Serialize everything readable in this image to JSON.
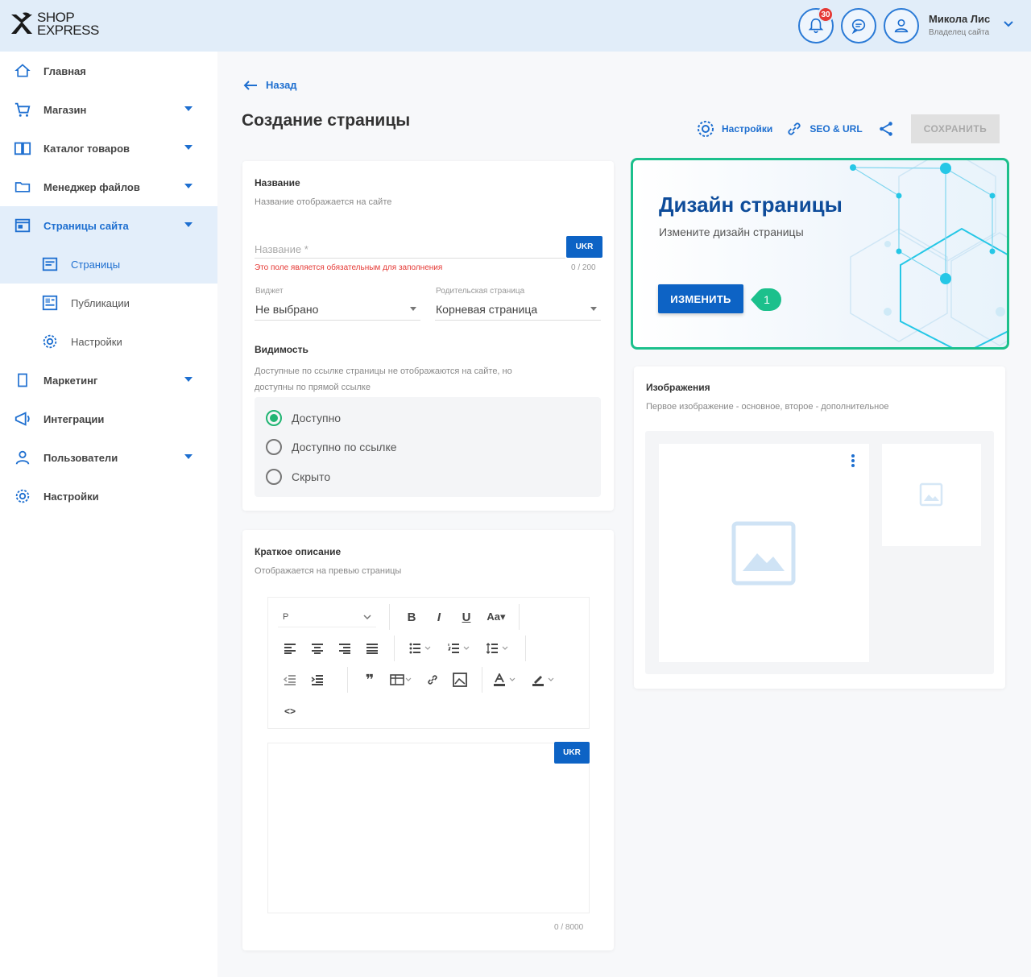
{
  "header": {
    "logo_line1": "SHOP",
    "logo_line2": "EXPRESS",
    "notification_count": "30",
    "user_name": "Микола Лис",
    "user_role": "Владелец сайта"
  },
  "sidebar": {
    "items": [
      {
        "label": "Главная",
        "icon": "home-icon",
        "has_chevron": false
      },
      {
        "label": "Магазин",
        "icon": "cart-icon",
        "has_chevron": true
      },
      {
        "label": "Каталог товаров",
        "icon": "book-icon",
        "has_chevron": true
      },
      {
        "label": "Менеджер файлов",
        "icon": "folder-icon",
        "has_chevron": true
      },
      {
        "label": "Страницы сайта",
        "icon": "pages-icon",
        "has_chevron": true,
        "active": true
      },
      {
        "label": "Маркетинг",
        "icon": "marketing-icon",
        "has_chevron": true
      },
      {
        "label": "Интеграции",
        "icon": "integrations-icon",
        "has_chevron": false
      },
      {
        "label": "Пользователи",
        "icon": "users-icon",
        "has_chevron": true
      },
      {
        "label": "Настройки",
        "icon": "gear-icon",
        "has_chevron": false
      }
    ],
    "sub_items": [
      {
        "label": "Страницы",
        "icon": "page-icon",
        "active": true
      },
      {
        "label": "Публикации",
        "icon": "news-icon"
      },
      {
        "label": "Настройки",
        "icon": "gear-icon"
      }
    ]
  },
  "main": {
    "back_label": "Назад",
    "page_title": "Создание страницы",
    "toolbar": {
      "settings_label": "Настройки",
      "seo_label": "SEO & URL",
      "save_label": "СОХРАНИТЬ"
    },
    "name_section": {
      "title": "Название",
      "hint": "Название отображается на сайте",
      "placeholder": "Название *",
      "lang": "UKR",
      "error": "Это поле является обязательным для заполнения",
      "counter": "0 / 200"
    },
    "widget": {
      "label": "Виджет",
      "value": "Не выбрано"
    },
    "parent": {
      "label": "Родительская страница",
      "value": "Корневая страница"
    },
    "visibility": {
      "title": "Видимость",
      "hint_line1": "Доступные по ссылке страницы не отображаются на сайте, но",
      "hint_line2": "доступны по прямой ссылке",
      "options": [
        "Доступно",
        "Доступно по ссылке",
        "Скрыто"
      ],
      "selected": "Доступно"
    },
    "short_desc": {
      "title": "Краткое описание",
      "hint": "Отображается на превью страницы",
      "format_value": "P",
      "lang": "UKR",
      "counter": "0 / 8000"
    },
    "design": {
      "title": "Дизайн страницы",
      "subtitle": "Измените дизайн страницы",
      "button": "ИЗМЕНИТЬ",
      "callout": "1",
      "accent": "#1cc08c"
    },
    "images": {
      "title": "Изображения",
      "hint": "Первое изображение - основное, второе - дополнительное"
    }
  },
  "colors": {
    "primary": "#0d63c5",
    "link": "#1e6fd0",
    "header_bg": "#e1edf9",
    "badge": "#e53935",
    "error": "#e53935",
    "success": "#21b573"
  }
}
